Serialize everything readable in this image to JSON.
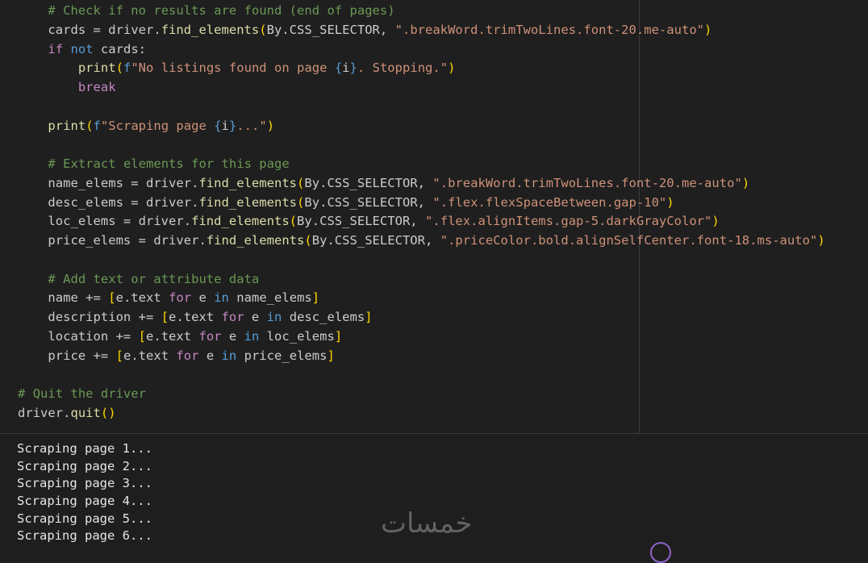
{
  "editor": {
    "lines": [
      [
        {
          "t": "    ",
          "c": "id"
        },
        {
          "t": "# Check if no results are found (end of pages)",
          "c": "cm"
        }
      ],
      [
        {
          "t": "    cards = driver.",
          "c": "id"
        },
        {
          "t": "find_elements",
          "c": "fn"
        },
        {
          "t": "(",
          "c": "b1"
        },
        {
          "t": "By.CSS_SELECTOR, ",
          "c": "id"
        },
        {
          "t": "\".breakWord.trimTwoLines.font-20.me-auto\"",
          "c": "str"
        },
        {
          "t": ")",
          "c": "b1"
        }
      ],
      [
        {
          "t": "    ",
          "c": "id"
        },
        {
          "t": "if",
          "c": "ctl"
        },
        {
          "t": " ",
          "c": "id"
        },
        {
          "t": "not",
          "c": "kw"
        },
        {
          "t": " cards:",
          "c": "id"
        }
      ],
      [
        {
          "t": "        ",
          "c": "id"
        },
        {
          "t": "print",
          "c": "fn"
        },
        {
          "t": "(",
          "c": "b1"
        },
        {
          "t": "f",
          "c": "kw"
        },
        {
          "t": "\"No listings found on page ",
          "c": "str"
        },
        {
          "t": "{",
          "c": "kw"
        },
        {
          "t": "i",
          "c": "id"
        },
        {
          "t": "}",
          "c": "kw"
        },
        {
          "t": ". Stopping.\"",
          "c": "str"
        },
        {
          "t": ")",
          "c": "b1"
        }
      ],
      [
        {
          "t": "        ",
          "c": "id"
        },
        {
          "t": "break",
          "c": "ctl"
        }
      ],
      [],
      [
        {
          "t": "    ",
          "c": "id"
        },
        {
          "t": "print",
          "c": "fn"
        },
        {
          "t": "(",
          "c": "b1"
        },
        {
          "t": "f",
          "c": "kw"
        },
        {
          "t": "\"Scraping page ",
          "c": "str"
        },
        {
          "t": "{",
          "c": "kw"
        },
        {
          "t": "i",
          "c": "id"
        },
        {
          "t": "}",
          "c": "kw"
        },
        {
          "t": "...\"",
          "c": "str"
        },
        {
          "t": ")",
          "c": "b1"
        }
      ],
      [],
      [
        {
          "t": "    ",
          "c": "id"
        },
        {
          "t": "# Extract elements for this page",
          "c": "cm"
        }
      ],
      [
        {
          "t": "    name_elems = driver.",
          "c": "id"
        },
        {
          "t": "find_elements",
          "c": "fn"
        },
        {
          "t": "(",
          "c": "b1"
        },
        {
          "t": "By.CSS_SELECTOR, ",
          "c": "id"
        },
        {
          "t": "\".breakWord.trimTwoLines.font-20.me-auto\"",
          "c": "str"
        },
        {
          "t": ")",
          "c": "b1"
        }
      ],
      [
        {
          "t": "    desc_elems = driver.",
          "c": "id"
        },
        {
          "t": "find_elements",
          "c": "fn"
        },
        {
          "t": "(",
          "c": "b1"
        },
        {
          "t": "By.CSS_SELECTOR, ",
          "c": "id"
        },
        {
          "t": "\".flex.flexSpaceBetween.gap-10\"",
          "c": "str"
        },
        {
          "t": ")",
          "c": "b1"
        }
      ],
      [
        {
          "t": "    loc_elems = driver.",
          "c": "id"
        },
        {
          "t": "find_elements",
          "c": "fn"
        },
        {
          "t": "(",
          "c": "b1"
        },
        {
          "t": "By.CSS_SELECTOR, ",
          "c": "id"
        },
        {
          "t": "\".flex.alignItems.gap-5.darkGrayColor\"",
          "c": "str"
        },
        {
          "t": ")",
          "c": "b1"
        }
      ],
      [
        {
          "t": "    price_elems = driver.",
          "c": "id"
        },
        {
          "t": "find_elements",
          "c": "fn"
        },
        {
          "t": "(",
          "c": "b1"
        },
        {
          "t": "By.CSS_SELECTOR, ",
          "c": "id"
        },
        {
          "t": "\".priceColor.bold.alignSelfCenter.font-18.ms-auto\"",
          "c": "str"
        },
        {
          "t": ")",
          "c": "b1"
        }
      ],
      [],
      [
        {
          "t": "    ",
          "c": "id"
        },
        {
          "t": "# Add text or attribute data",
          "c": "cm"
        }
      ],
      [
        {
          "t": "    name += ",
          "c": "id"
        },
        {
          "t": "[",
          "c": "b1"
        },
        {
          "t": "e.text ",
          "c": "id"
        },
        {
          "t": "for",
          "c": "ctl"
        },
        {
          "t": " e ",
          "c": "id"
        },
        {
          "t": "in",
          "c": "kw"
        },
        {
          "t": " name_elems",
          "c": "id"
        },
        {
          "t": "]",
          "c": "b1"
        }
      ],
      [
        {
          "t": "    description += ",
          "c": "id"
        },
        {
          "t": "[",
          "c": "b1"
        },
        {
          "t": "e.text ",
          "c": "id"
        },
        {
          "t": "for",
          "c": "ctl"
        },
        {
          "t": " e ",
          "c": "id"
        },
        {
          "t": "in",
          "c": "kw"
        },
        {
          "t": " desc_elems",
          "c": "id"
        },
        {
          "t": "]",
          "c": "b1"
        }
      ],
      [
        {
          "t": "    location += ",
          "c": "id"
        },
        {
          "t": "[",
          "c": "b1"
        },
        {
          "t": "e.text ",
          "c": "id"
        },
        {
          "t": "for",
          "c": "ctl"
        },
        {
          "t": " e ",
          "c": "id"
        },
        {
          "t": "in",
          "c": "kw"
        },
        {
          "t": " loc_elems",
          "c": "id"
        },
        {
          "t": "]",
          "c": "b1"
        }
      ],
      [
        {
          "t": "    price += ",
          "c": "id"
        },
        {
          "t": "[",
          "c": "b1"
        },
        {
          "t": "e.text ",
          "c": "id"
        },
        {
          "t": "for",
          "c": "ctl"
        },
        {
          "t": " e ",
          "c": "id"
        },
        {
          "t": "in",
          "c": "kw"
        },
        {
          "t": " price_elems",
          "c": "id"
        },
        {
          "t": "]",
          "c": "b1"
        }
      ],
      [],
      [
        {
          "t": "# Quit the driver",
          "c": "cm"
        }
      ],
      [
        {
          "t": "driver.",
          "c": "id"
        },
        {
          "t": "quit",
          "c": "fn"
        },
        {
          "t": "(",
          "c": "b1"
        },
        {
          "t": ")",
          "c": "b1"
        }
      ]
    ]
  },
  "output": {
    "lines": [
      "Scraping page 1...",
      "Scraping page 2...",
      "Scraping page 3...",
      "Scraping page 4...",
      "Scraping page 5...",
      "Scraping page 6..."
    ]
  },
  "watermark": {
    "text": "خمسات"
  },
  "colors": {
    "background": "#1f1f1f",
    "comment": "#6a9955",
    "keyword": "#569cd6",
    "control": "#c586c0",
    "string": "#ce9178",
    "bracket": "#ffd700",
    "function": "#dcdcaa",
    "text": "#cccccc"
  }
}
